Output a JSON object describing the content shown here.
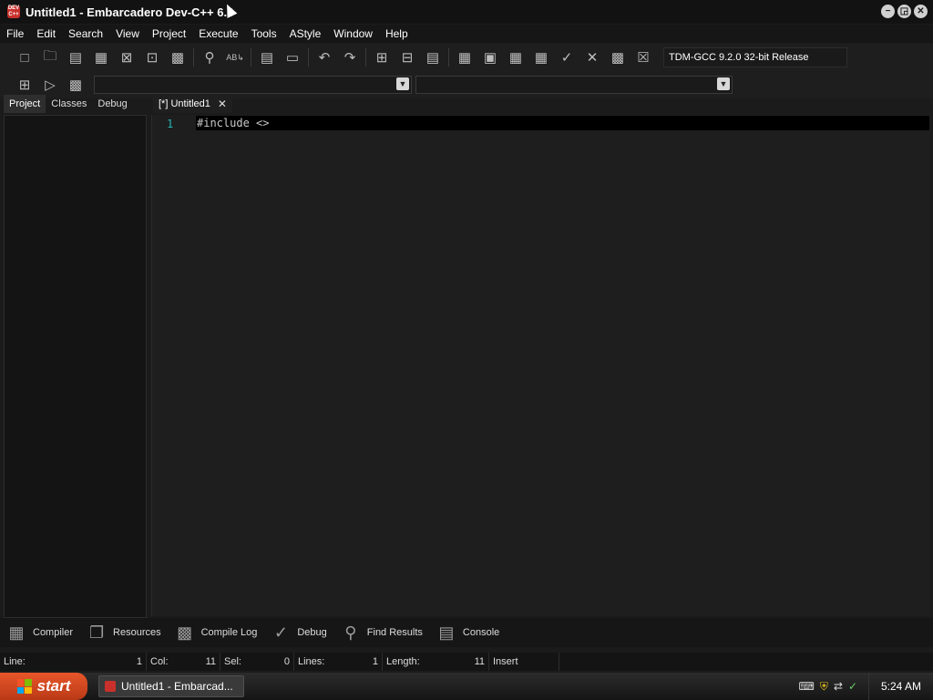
{
  "window": {
    "logo_text": "DEV C++",
    "title": "Untitled1 - Embarcadero Dev-C++ 6.3",
    "controls": {
      "minimize": "−",
      "restore": "◲",
      "close": "✕"
    }
  },
  "menu": [
    "File",
    "Edit",
    "Search",
    "View",
    "Project",
    "Execute",
    "Tools",
    "AStyle",
    "Window",
    "Help"
  ],
  "toolbar": {
    "compiler_select": "TDM-GCC 9.2.0 32-bit Release"
  },
  "left_panel": {
    "tabs": [
      "Project",
      "Classes",
      "Debug"
    ]
  },
  "editor": {
    "tab_label": "[*] Untitled1",
    "line_number": "1",
    "code": "#include <>"
  },
  "bottom_tabs": [
    "Compiler",
    "Resources",
    "Compile Log",
    "Debug",
    "Find Results",
    "Console"
  ],
  "status": {
    "line_label": "Line:",
    "line_value": "1",
    "col_label": "Col:",
    "col_value": "11",
    "sel_label": "Sel:",
    "sel_value": "0",
    "lines_label": "Lines:",
    "lines_value": "1",
    "length_label": "Length:",
    "length_value": "11",
    "mode": "Insert"
  },
  "taskbar": {
    "start_label": "start",
    "task_label": "Untitled1 - Embarcad...",
    "clock": "5:24 AM"
  },
  "colors": {
    "accent_line_number": "#26b5b5",
    "start_button": "#d9481f",
    "dev_logo": "#c9302c"
  }
}
